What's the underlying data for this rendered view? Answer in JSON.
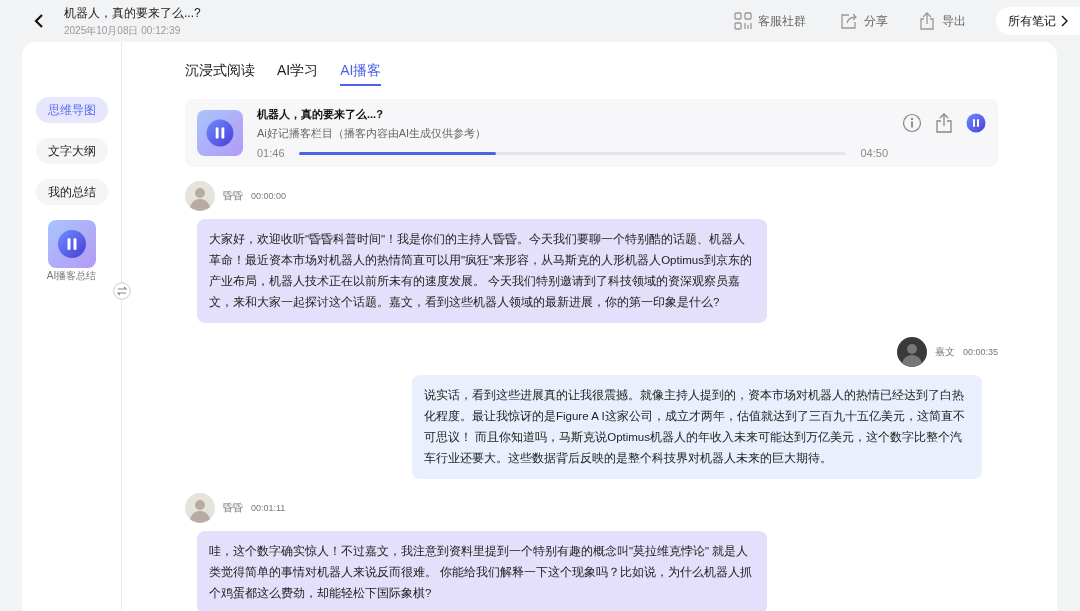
{
  "header": {
    "title": "机器人，真的要来了么...?",
    "date": "2025年10月08日 00:12:39",
    "actions": [
      {
        "kind": "community",
        "label": "客服社群"
      },
      {
        "kind": "share",
        "label": "分享"
      },
      {
        "kind": "export",
        "label": "导出"
      }
    ],
    "notes_button": "所有笔记"
  },
  "sidebar": {
    "items": [
      {
        "label": "思维导图",
        "selected": true
      },
      {
        "label": "文字大纲",
        "selected": false
      },
      {
        "label": "我的总结",
        "selected": false
      }
    ],
    "podcast_label": "AI播客总结"
  },
  "tabs": [
    {
      "label": "沉浸式阅读",
      "selected": false
    },
    {
      "label": "AI学习",
      "selected": false
    },
    {
      "label": "AI播客",
      "selected": true
    }
  ],
  "player": {
    "title": "机器人，真的要来了么...?",
    "subtitle": "Ai好记播客栏目（播客内容由AI生成仅供参考）",
    "elapsed": "01:46",
    "duration": "04:50",
    "level": 0.36
  },
  "messages": [
    {
      "kind": "host",
      "speaker": "昏昏",
      "time": "00:00:00",
      "text": "大家好，欢迎收听\"昏昏科普时间\"！我是你们的主持人昏昏。今天我们要聊一个特别酷的话题、机器人革命！最近资本市场对机器人的热情简直可以用\"疯狂\"来形容，从马斯克的人形机器人Optimus到京东的产业布局，机器人技术正在以前所未有的速度发展。 今天我们特别邀请到了科技领域的资深观察员嘉文，来和大家一起探讨这个话题。嘉文，看到这些机器人领域的最新进展，你的第一印象是什么?"
    },
    {
      "kind": "guest",
      "speaker": "嘉文",
      "time": "00:00:35",
      "text": "说实话，看到这些进展真的让我很震撼。就像主持人提到的，资本市场对机器人的热情已经达到了白热化程度。最让我惊讶的是Figure A I这家公司，成立才两年，估值就达到了三百九十五亿美元，这简直不可思议！ 而且你知道吗，马斯克说Optimus机器人的年收入未来可能达到万亿美元，这个数字比整个汽车行业还要大。这些数据背后反映的是整个科技界对机器人未来的巨大期待。"
    },
    {
      "kind": "host",
      "speaker": "昏昏",
      "time": "00:01:11",
      "text": "哇，这个数字确实惊人！不过嘉文，我注意到资料里提到一个特别有趣的概念叫\"莫拉维克悖论\" 就是人类觉得简单的事情对机器人来说反而很难。 你能给我们解释一下这个现象吗？比如说，为什么机器人抓个鸡蛋都这么费劲，却能轻松下国际象棋?"
    }
  ]
}
